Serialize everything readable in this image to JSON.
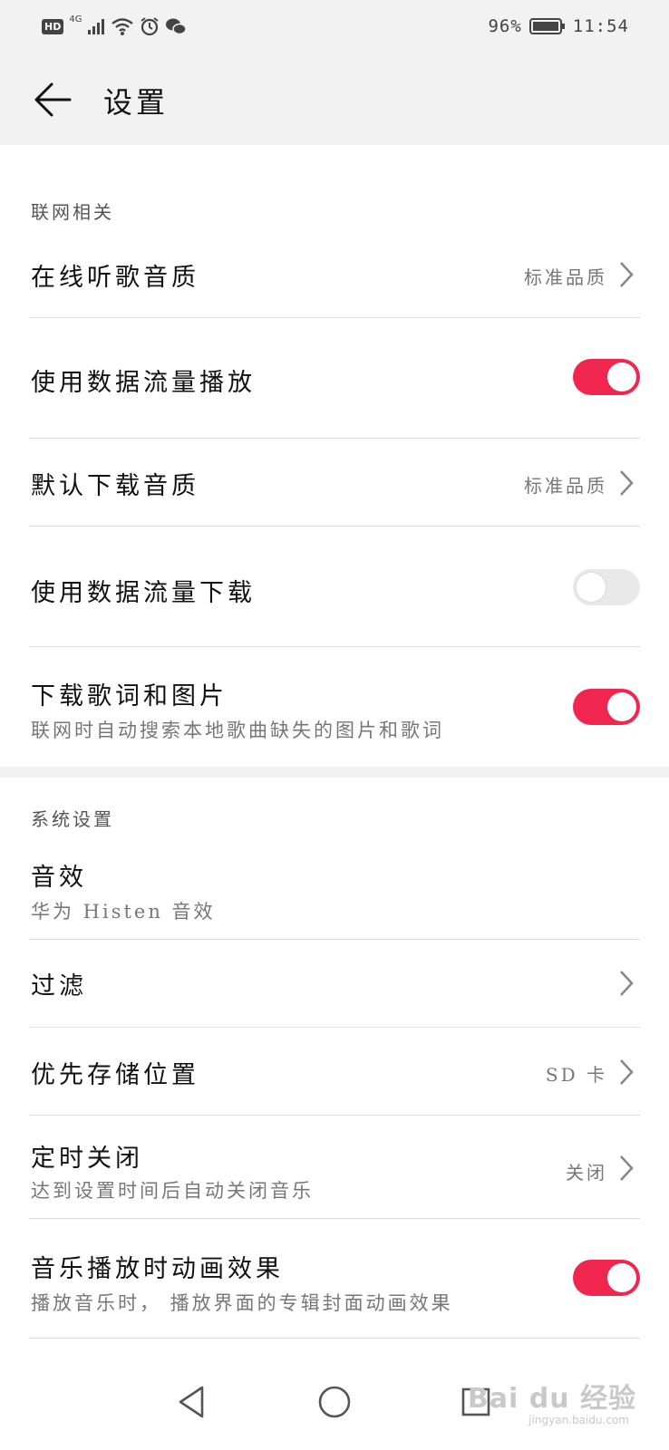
{
  "status_bar": {
    "left_badge": "HD",
    "network": "4G",
    "battery": "96%",
    "time": "11:54"
  },
  "header": {
    "title": "设置"
  },
  "sections": [
    {
      "title": "联网相关",
      "items": [
        {
          "label": "在线听歌音质",
          "value": "标准品质"
        },
        {
          "label": "使用数据流量播放",
          "toggle": true
        },
        {
          "label": "默认下载音质",
          "value": "标准品质"
        },
        {
          "label": "使用数据流量下载",
          "toggle": false
        },
        {
          "label": "下载歌词和图片",
          "subtitle": "联网时自动搜索本地歌曲缺失的图片和歌词",
          "toggle": true
        }
      ]
    },
    {
      "title": "系统设置",
      "items": [
        {
          "label": "音效",
          "subtitle": "华为 Histen 音效"
        },
        {
          "label": "过滤"
        },
        {
          "label": "优先存储位置",
          "value": "SD 卡"
        },
        {
          "label": "定时关闭",
          "subtitle": "达到设置时间后自动关闭音乐",
          "value": "关闭"
        },
        {
          "label": "音乐播放时动画效果",
          "subtitle": "播放音乐时， 播放界面的专辑封面动画效果",
          "toggle": true
        }
      ]
    }
  ],
  "watermark": {
    "brand": "Bai du 经验",
    "url": "jingyan.baidu.com"
  },
  "colors": {
    "accent": "#f0264f",
    "header_bg": "#f2f2f2"
  }
}
